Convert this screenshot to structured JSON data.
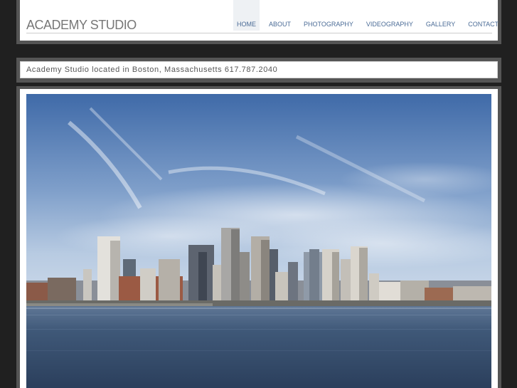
{
  "header": {
    "logo": "ACADEMY STUDIO",
    "nav": [
      {
        "label": "HOME",
        "active": true
      },
      {
        "label": "ABOUT",
        "active": false
      },
      {
        "label": "PHOTOGRAPHY",
        "active": false
      },
      {
        "label": "VIDEOGRAPHY",
        "active": false
      },
      {
        "label": "GALLERY",
        "active": false
      },
      {
        "label": "CONTACT",
        "active": false
      }
    ]
  },
  "tagline": {
    "text": "Academy Studio located in Boston, Massachusetts 617.787.2040"
  },
  "hero": {
    "icon": "boston-skyline-photo"
  },
  "colors": {
    "page_background": "#202020",
    "frame": "#555555",
    "nav_link": "#4a6b96",
    "logo": "#777777"
  }
}
